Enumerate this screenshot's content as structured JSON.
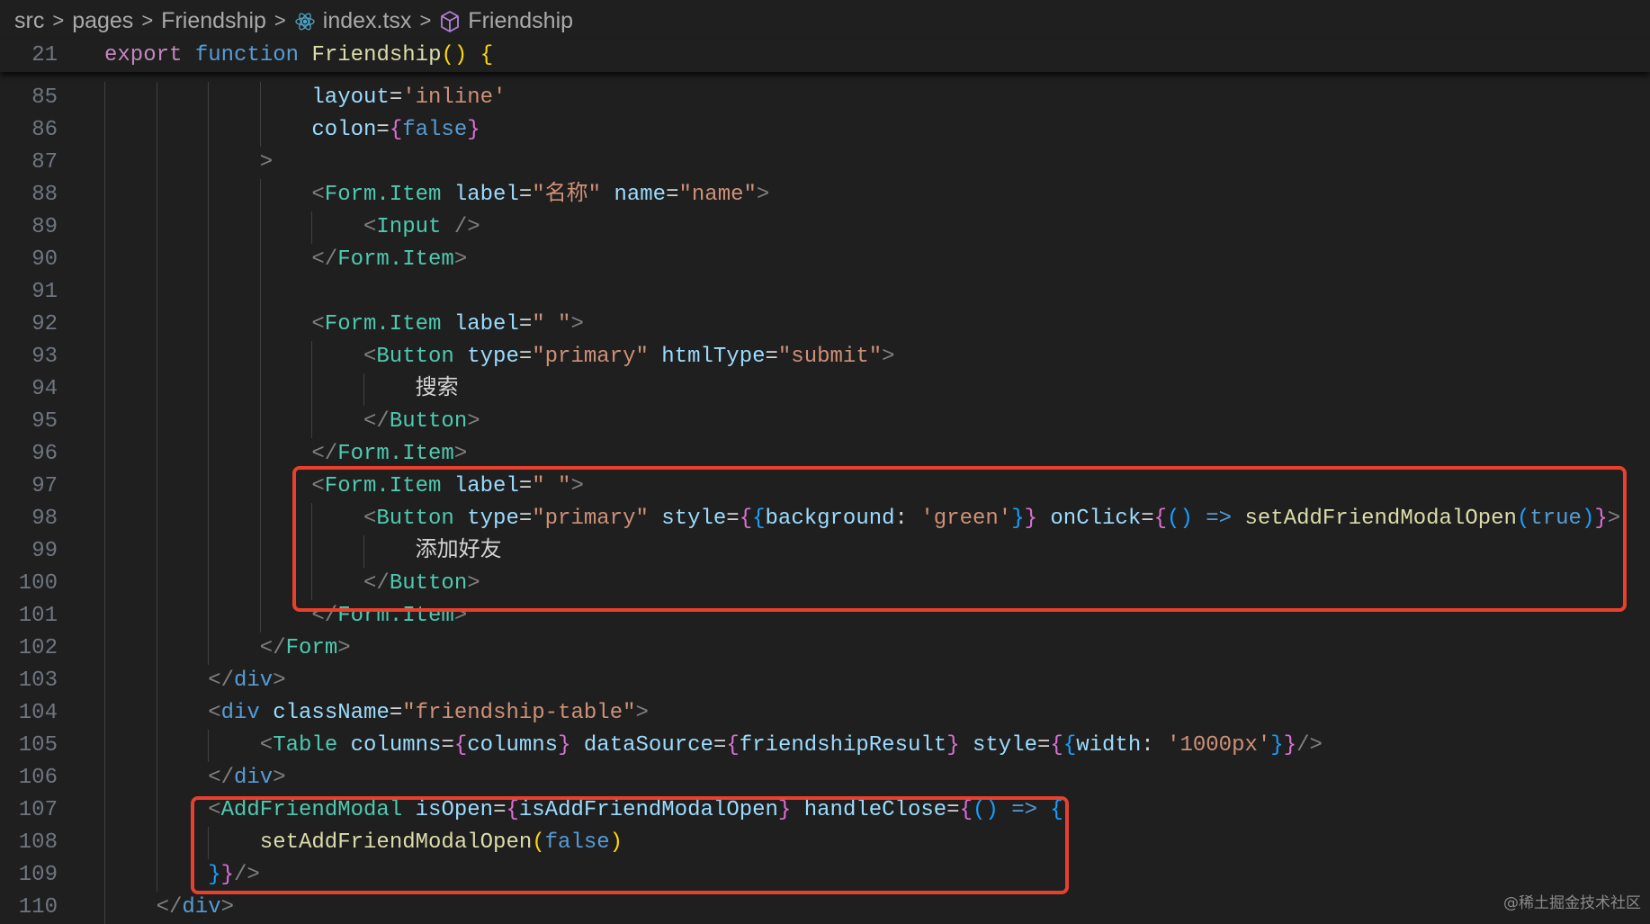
{
  "breadcrumb": {
    "items": [
      "src",
      "pages",
      "Friendship",
      "index.tsx",
      "Friendship"
    ],
    "separator": ">"
  },
  "sticky_line": {
    "number": "21",
    "indent": 0,
    "guides": 0,
    "tokens": [
      [
        "export",
        "k"
      ],
      [
        " ",
        "w"
      ],
      [
        "function",
        "b"
      ],
      [
        " ",
        "w"
      ],
      [
        "Friendship",
        "f"
      ],
      [
        "()",
        "y"
      ],
      [
        " ",
        "w"
      ],
      [
        "{",
        "y"
      ]
    ]
  },
  "lines": [
    {
      "number": "85",
      "indent": 4,
      "guides": 4,
      "tokens": [
        [
          "layout",
          "a"
        ],
        [
          "=",
          "w"
        ],
        [
          "'inline'",
          "s"
        ]
      ]
    },
    {
      "number": "86",
      "indent": 4,
      "guides": 4,
      "tokens": [
        [
          "colon",
          "a"
        ],
        [
          "=",
          "w"
        ],
        [
          "{",
          "m"
        ],
        [
          "false",
          "b"
        ],
        [
          "}",
          "m"
        ]
      ]
    },
    {
      "number": "87",
      "indent": 3,
      "guides": 3,
      "tokens": [
        [
          ">",
          "p"
        ]
      ]
    },
    {
      "number": "88",
      "indent": 4,
      "guides": 4,
      "tokens": [
        [
          "<",
          "p"
        ],
        [
          "Form.Item",
          "tg"
        ],
        [
          " ",
          "w"
        ],
        [
          "label",
          "a"
        ],
        [
          "=",
          "w"
        ],
        [
          "\"名称\"",
          "s"
        ],
        [
          " ",
          "w"
        ],
        [
          "name",
          "a"
        ],
        [
          "=",
          "w"
        ],
        [
          "\"name\"",
          "s"
        ],
        [
          ">",
          "p"
        ]
      ]
    },
    {
      "number": "89",
      "indent": 5,
      "guides": 5,
      "tokens": [
        [
          "<",
          "p"
        ],
        [
          "Input",
          "tg"
        ],
        [
          " ",
          "w"
        ],
        [
          "/>",
          "p"
        ]
      ]
    },
    {
      "number": "90",
      "indent": 4,
      "guides": 4,
      "tokens": [
        [
          "</",
          "p"
        ],
        [
          "Form.Item",
          "tg"
        ],
        [
          ">",
          "p"
        ]
      ]
    },
    {
      "number": "91",
      "indent": 4,
      "guides": 4,
      "tokens": []
    },
    {
      "number": "92",
      "indent": 4,
      "guides": 4,
      "tokens": [
        [
          "<",
          "p"
        ],
        [
          "Form.Item",
          "tg"
        ],
        [
          " ",
          "w"
        ],
        [
          "label",
          "a"
        ],
        [
          "=",
          "w"
        ],
        [
          "\" \"",
          "s"
        ],
        [
          ">",
          "p"
        ]
      ]
    },
    {
      "number": "93",
      "indent": 5,
      "guides": 5,
      "tokens": [
        [
          "<",
          "p"
        ],
        [
          "Button",
          "tg"
        ],
        [
          " ",
          "w"
        ],
        [
          "type",
          "a"
        ],
        [
          "=",
          "w"
        ],
        [
          "\"primary\"",
          "s"
        ],
        [
          " ",
          "w"
        ],
        [
          "htmlType",
          "a"
        ],
        [
          "=",
          "w"
        ],
        [
          "\"submit\"",
          "s"
        ],
        [
          ">",
          "p"
        ]
      ]
    },
    {
      "number": "94",
      "indent": 6,
      "guides": 6,
      "tokens": [
        [
          "搜索",
          "w"
        ]
      ]
    },
    {
      "number": "95",
      "indent": 5,
      "guides": 5,
      "tokens": [
        [
          "</",
          "p"
        ],
        [
          "Button",
          "tg"
        ],
        [
          ">",
          "p"
        ]
      ]
    },
    {
      "number": "96",
      "indent": 4,
      "guides": 4,
      "tokens": [
        [
          "</",
          "p"
        ],
        [
          "Form.Item",
          "tg"
        ],
        [
          ">",
          "p"
        ]
      ]
    },
    {
      "number": "97",
      "indent": 4,
      "guides": 4,
      "tokens": [
        [
          "<",
          "p"
        ],
        [
          "Form.Item",
          "tg"
        ],
        [
          " ",
          "w"
        ],
        [
          "label",
          "a"
        ],
        [
          "=",
          "w"
        ],
        [
          "\" \"",
          "s"
        ],
        [
          ">",
          "p"
        ]
      ]
    },
    {
      "number": "98",
      "indent": 5,
      "guides": 5,
      "tokens": [
        [
          "<",
          "p"
        ],
        [
          "Button",
          "tg"
        ],
        [
          " ",
          "w"
        ],
        [
          "type",
          "a"
        ],
        [
          "=",
          "w"
        ],
        [
          "\"primary\"",
          "s"
        ],
        [
          " ",
          "w"
        ],
        [
          "style",
          "a"
        ],
        [
          "=",
          "w"
        ],
        [
          "{",
          "m"
        ],
        [
          "{",
          "bl"
        ],
        [
          "background",
          "a"
        ],
        [
          ": ",
          "w"
        ],
        [
          "'green'",
          "s"
        ],
        [
          "}",
          "bl"
        ],
        [
          "}",
          "m"
        ],
        [
          " ",
          "w"
        ],
        [
          "onClick",
          "a"
        ],
        [
          "=",
          "w"
        ],
        [
          "{",
          "m"
        ],
        [
          "()",
          "bl"
        ],
        [
          " ",
          "w"
        ],
        [
          "=>",
          "b"
        ],
        [
          " ",
          "w"
        ],
        [
          "setAddFriendModalOpen",
          "f"
        ],
        [
          "(",
          "bl"
        ],
        [
          "true",
          "b"
        ],
        [
          ")",
          "bl"
        ],
        [
          "}",
          "m"
        ],
        [
          ">",
          "p"
        ]
      ]
    },
    {
      "number": "99",
      "indent": 6,
      "guides": 6,
      "tokens": [
        [
          "添加好友",
          "w"
        ]
      ]
    },
    {
      "number": "100",
      "indent": 5,
      "guides": 5,
      "tokens": [
        [
          "</",
          "p"
        ],
        [
          "Button",
          "tg"
        ],
        [
          ">",
          "p"
        ]
      ]
    },
    {
      "number": "101",
      "indent": 4,
      "guides": 4,
      "tokens": [
        [
          "</",
          "p"
        ],
        [
          "Form.Item",
          "tg"
        ],
        [
          ">",
          "p"
        ]
      ]
    },
    {
      "number": "102",
      "indent": 3,
      "guides": 3,
      "tokens": [
        [
          "</",
          "p"
        ],
        [
          "Form",
          "tg"
        ],
        [
          ">",
          "p"
        ]
      ]
    },
    {
      "number": "103",
      "indent": 2,
      "guides": 2,
      "tokens": [
        [
          "</",
          "p"
        ],
        [
          "div",
          "b"
        ],
        [
          ">",
          "p"
        ]
      ]
    },
    {
      "number": "104",
      "indent": 2,
      "guides": 2,
      "tokens": [
        [
          "<",
          "p"
        ],
        [
          "div",
          "b"
        ],
        [
          " ",
          "w"
        ],
        [
          "className",
          "a"
        ],
        [
          "=",
          "w"
        ],
        [
          "\"friendship-table\"",
          "s"
        ],
        [
          ">",
          "p"
        ]
      ]
    },
    {
      "number": "105",
      "indent": 3,
      "guides": 3,
      "tokens": [
        [
          "<",
          "p"
        ],
        [
          "Table",
          "tg"
        ],
        [
          " ",
          "w"
        ],
        [
          "columns",
          "a"
        ],
        [
          "=",
          "w"
        ],
        [
          "{",
          "m"
        ],
        [
          "columns",
          "a"
        ],
        [
          "}",
          "m"
        ],
        [
          " ",
          "w"
        ],
        [
          "dataSource",
          "a"
        ],
        [
          "=",
          "w"
        ],
        [
          "{",
          "m"
        ],
        [
          "friendshipResult",
          "a"
        ],
        [
          "}",
          "m"
        ],
        [
          " ",
          "w"
        ],
        [
          "style",
          "a"
        ],
        [
          "=",
          "w"
        ],
        [
          "{",
          "m"
        ],
        [
          "{",
          "bl"
        ],
        [
          "width",
          "a"
        ],
        [
          ": ",
          "w"
        ],
        [
          "'1000px'",
          "s"
        ],
        [
          "}",
          "bl"
        ],
        [
          "}",
          "m"
        ],
        [
          "/>",
          "p"
        ]
      ]
    },
    {
      "number": "106",
      "indent": 2,
      "guides": 2,
      "tokens": [
        [
          "</",
          "p"
        ],
        [
          "div",
          "b"
        ],
        [
          ">",
          "p"
        ]
      ]
    },
    {
      "number": "107",
      "indent": 2,
      "guides": 2,
      "tokens": [
        [
          "<",
          "p"
        ],
        [
          "AddFriendModal",
          "tg"
        ],
        [
          " ",
          "w"
        ],
        [
          "isOpen",
          "a"
        ],
        [
          "=",
          "w"
        ],
        [
          "{",
          "m"
        ],
        [
          "isAddFriendModalOpen",
          "a"
        ],
        [
          "}",
          "m"
        ],
        [
          " ",
          "w"
        ],
        [
          "handleClose",
          "a"
        ],
        [
          "=",
          "w"
        ],
        [
          "{",
          "m"
        ],
        [
          "()",
          "bl"
        ],
        [
          " ",
          "w"
        ],
        [
          "=>",
          "b"
        ],
        [
          " ",
          "w"
        ],
        [
          "{",
          "bl"
        ]
      ]
    },
    {
      "number": "108",
      "indent": 3,
      "guides": 3,
      "tokens": [
        [
          "setAddFriendModalOpen",
          "f"
        ],
        [
          "(",
          "y"
        ],
        [
          "false",
          "b"
        ],
        [
          ")",
          "y"
        ]
      ]
    },
    {
      "number": "109",
      "indent": 2,
      "guides": 2,
      "tokens": [
        [
          "}",
          "bl"
        ],
        [
          "}",
          "m"
        ],
        [
          "/>",
          "p"
        ]
      ]
    },
    {
      "number": "110",
      "indent": 1,
      "guides": 1,
      "tokens": [
        [
          "</",
          "p"
        ],
        [
          "div",
          "b"
        ],
        [
          ">",
          "p"
        ]
      ]
    }
  ],
  "highlight_color": "#e8402c",
  "watermark": "@稀土掘金技术社区"
}
